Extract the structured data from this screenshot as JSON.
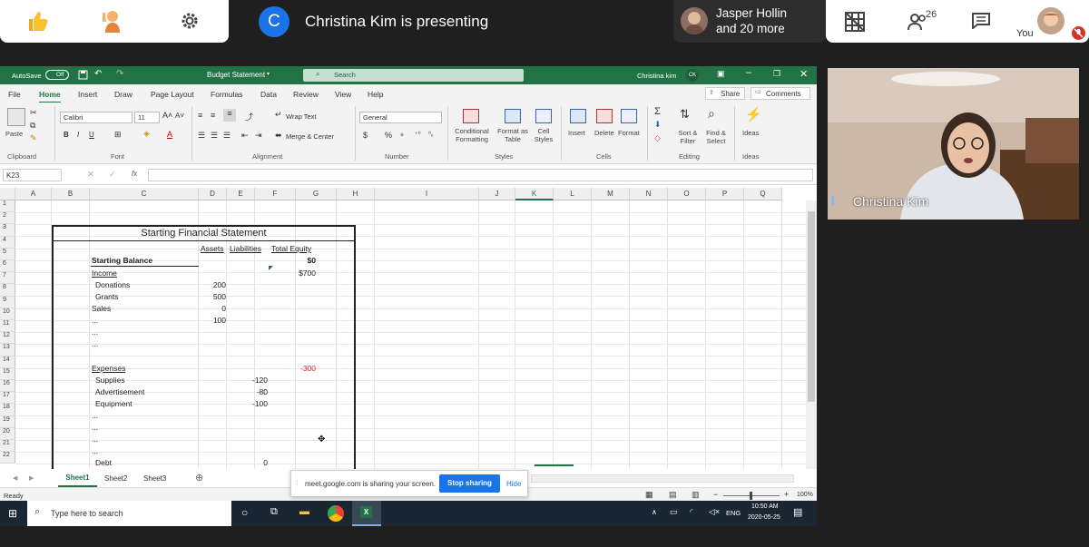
{
  "meet": {
    "presenter_initial": "C",
    "presenting_text": "Christina Kim is presenting",
    "others_line1": "Jasper Hollin",
    "others_line2": "and 20 more",
    "participant_count": "26",
    "you_label": "You",
    "video_name": "Christina Kim"
  },
  "excel": {
    "autosave_label": "AutoSave",
    "autosave_state": "Off",
    "doc_title": "Budget Statement",
    "search_placeholder": "Search",
    "user_name": "Christina kim",
    "user_initials": "CK",
    "menu": [
      "File",
      "Home",
      "Insert",
      "Draw",
      "Page Layout",
      "Formulas",
      "Data",
      "Review",
      "View",
      "Help"
    ],
    "share_label": "Share",
    "comments_label": "Comments",
    "ribbon": {
      "paste": "Paste",
      "font_name": "Calibri",
      "font_size": "11",
      "wrap_text": "Wrap Text",
      "merge_center": "Merge & Center",
      "number_format": "General",
      "conditional_formatting": "Conditional Formatting",
      "format_as_table": "Format as Table",
      "cell_styles": "Cell Styles",
      "insert": "Insert",
      "delete": "Delete",
      "format": "Format",
      "sort_filter": "Sort & Filter",
      "find_select": "Find & Select",
      "ideas": "Ideas",
      "groups": [
        "Clipboard",
        "Font",
        "Alignment",
        "Number",
        "Styles",
        "Cells",
        "Editing",
        "Ideas"
      ]
    },
    "name_box": "K23",
    "fx": "fx",
    "columns": [
      "A",
      "B",
      "C",
      "D",
      "E",
      "F",
      "G",
      "H",
      "I",
      "J",
      "K",
      "L",
      "M",
      "N",
      "O",
      "P",
      "Q"
    ],
    "rows": [
      "1",
      "2",
      "3",
      "4",
      "5",
      "6",
      "7",
      "8",
      "9",
      "10",
      "11",
      "12",
      "13",
      "14",
      "15",
      "16",
      "17",
      "18",
      "19",
      "20",
      "21",
      "22"
    ],
    "sheet": {
      "title": "Starting Financial Statement",
      "hdr_assets": "Assets",
      "hdr_liabilities": "Liabilities",
      "hdr_equity": "Total Equity",
      "starting_balance": "Starting Balance",
      "starting_balance_value": "$0",
      "income": "Income",
      "income_total": "$700",
      "donations": "Donations",
      "donations_value": "200",
      "grants": "Grants",
      "grants_value": "500",
      "sales": "Sales",
      "sales_value": "0",
      "r10": "...",
      "r10_value": "100",
      "r11": "...",
      "r12": "...",
      "expenses": "Expenses",
      "expenses_total": "-300",
      "supplies": "Supplies",
      "supplies_value": "-120",
      "advertisement": "Advertisement",
      "advertisement_value": "-80",
      "equipment": "Equipment",
      "equipment_value": "-100",
      "r18": "...",
      "r19": "...",
      "r20": "...",
      "r21": "...",
      "debt": "Debt",
      "debt_value": "0"
    },
    "tabs": [
      "Sheet1",
      "Sheet2",
      "Sheet3"
    ],
    "status": "Ready",
    "zoom": "100%",
    "share_notice": "meet.google.com is sharing your screen.",
    "stop_sharing": "Stop sharing",
    "hide": "Hide",
    "taskbar_search": "Type here to search",
    "lang": "ENG",
    "time": "10:50 AM",
    "date": "2020-05-25"
  },
  "colors": {
    "excel_green": "#217346",
    "meet_blue": "#1a73e8",
    "negative": "#e02020"
  }
}
